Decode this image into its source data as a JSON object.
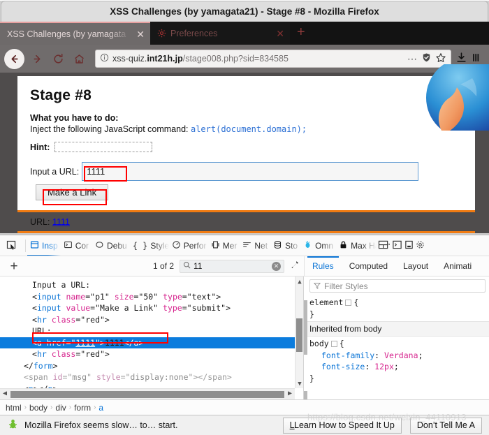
{
  "window": {
    "title": "XSS Challenges (by yamagata21) - Stage #8 - Mozilla Firefox"
  },
  "tabs": [
    {
      "title": "XSS Challenges (by yamagata",
      "close": "✕",
      "active": true,
      "favicon": "none"
    },
    {
      "title": "Preferences",
      "close": "✕",
      "active": false,
      "favicon": "gear-icon"
    }
  ],
  "new_tab_label": "+",
  "navbar": {
    "back_icon": "←",
    "forward_icon": "→",
    "reload_icon": "⟳",
    "home_icon": "⌂",
    "info_icon": "ⓘ",
    "url_prefix": "xss-quiz.",
    "url_host": "int21h.jp",
    "url_path": "/stage008.php?sid=834585",
    "menu_icon": "…",
    "shield_icon": "shield",
    "star_icon": "☆",
    "download_icon": "⬇",
    "library_icon": "library"
  },
  "page": {
    "stage_title": "Stage #8",
    "todo_heading": "What you have to do:",
    "todo_text": "Inject the following JavaScript command: ",
    "todo_code": "alert(document.domain);",
    "hint_label": "Hint:",
    "hint_value": "",
    "input_label": "Input a URL:",
    "input_value": "1111",
    "input_placeholder": "",
    "submit_label": "Make a Link",
    "result_label": "URL: ",
    "result_link": "1111"
  },
  "devtools": {
    "picker_icon": "element-picker-icon",
    "tabs": [
      {
        "label": "Insp",
        "full": "Inspector",
        "icon": "inspector-icon",
        "active": true
      },
      {
        "label": "Cor",
        "full": "Console",
        "icon": "console-icon",
        "active": false
      },
      {
        "label": "Debu",
        "full": "Debugger",
        "icon": "debugger-icon",
        "active": false
      },
      {
        "label": "Style",
        "full": "Style Editor",
        "icon": "style-editor-icon",
        "active": false
      },
      {
        "label": "Perfor",
        "full": "Performance",
        "icon": "performance-icon",
        "active": false
      },
      {
        "label": "Mer",
        "full": "Memory",
        "icon": "memory-icon",
        "active": false
      },
      {
        "label": "Net",
        "full": "Network",
        "icon": "network-icon",
        "active": false
      },
      {
        "label": "Sto",
        "full": "Storage",
        "icon": "storage-icon",
        "active": false
      },
      {
        "label": "Omn",
        "full": "Omnibug",
        "icon": "omnibug-icon",
        "active": false
      },
      {
        "label": "Max Ha",
        "full": "Max HAR",
        "icon": "lock-icon",
        "active": false
      }
    ],
    "right_icons": [
      "layout-toggle-icon",
      "dock-side-icon",
      "dock-bottom-icon",
      "settings-icon"
    ],
    "search": {
      "add_node_label": "+",
      "match_count": "1 of 2",
      "value": "11",
      "placeholder": "Search HTML",
      "search_icon": "search-icon",
      "clear_icon": "✕",
      "eyedropper_icon": "eyedropper-icon"
    },
    "markup": [
      {
        "indent": 1,
        "type": "text",
        "content": "Input a URL:"
      },
      {
        "indent": 1,
        "type": "tag",
        "tag": "input",
        "attrs": [
          [
            "name",
            "p1"
          ],
          [
            "size",
            "50"
          ],
          [
            "type",
            "text"
          ]
        ]
      },
      {
        "indent": 1,
        "type": "tag",
        "tag": "input",
        "attrs": [
          [
            "value",
            "Make a Link"
          ],
          [
            "type",
            "submit"
          ]
        ]
      },
      {
        "indent": 1,
        "type": "tag",
        "tag": "hr",
        "attrs": [
          [
            "class",
            "red"
          ]
        ]
      },
      {
        "indent": 1,
        "type": "text",
        "content": "URL:"
      },
      {
        "indent": 1,
        "type": "anchor",
        "tag": "a",
        "attrs": [
          [
            "href",
            "1111"
          ]
        ],
        "inner": "1111",
        "selected": true
      },
      {
        "indent": 1,
        "type": "tag",
        "tag": "hr",
        "attrs": [
          [
            "class",
            "red"
          ]
        ]
      },
      {
        "indent": 2,
        "type": "close",
        "tag": "form"
      },
      {
        "indent": 2,
        "type": "greytag",
        "tag": "span",
        "attrs": [
          [
            "id",
            "msg"
          ],
          [
            "style",
            "display:none"
          ]
        ],
        "inner": ""
      },
      {
        "indent": 2,
        "type": "pair",
        "tag": "p",
        "inner": ""
      }
    ],
    "rules_tabs": [
      {
        "label": "Rules",
        "active": true
      },
      {
        "label": "Computed",
        "active": false
      },
      {
        "label": "Layout",
        "active": false
      },
      {
        "label": "Animati",
        "active": false
      }
    ],
    "rules": {
      "filter_placeholder": "Filter Styles",
      "filter_icon": "filter-icon",
      "blocks": [
        {
          "selector": "element",
          "open": "{",
          "close": "}",
          "declarations": []
        },
        {
          "header": "Inherited from body"
        },
        {
          "selector": "body",
          "open": "{",
          "close": "}",
          "declarations": [
            {
              "prop": "font-family",
              "value": "Verdana"
            },
            {
              "prop": "font-size",
              "value": "12px"
            }
          ]
        }
      ]
    },
    "breadcrumb": [
      {
        "label": "html",
        "active": false
      },
      {
        "label": "body",
        "active": false
      },
      {
        "label": "div",
        "active": false
      },
      {
        "label": "form",
        "active": false
      },
      {
        "label": "a",
        "active": true
      }
    ],
    "breadcrumb_sep": "›"
  },
  "notification": {
    "icon": "firefox-slow-icon",
    "message": "Mozilla Firefox seems slow… to… start.",
    "primary_label": "Learn How to Speed It Up",
    "secondary_label": "Don’t Tell Me A"
  },
  "watermark": "https://blog.csdn.net/weixin_44110913",
  "colors": {
    "accent_blue": "#0a74d6",
    "selection_blue": "#0b7cdd",
    "annotation_red": "#ff0000",
    "hr_orange": "#f07b12",
    "link_blue": "#0000ee",
    "code_blue": "#2b6fd4",
    "attr_pink": "#d6258e"
  }
}
